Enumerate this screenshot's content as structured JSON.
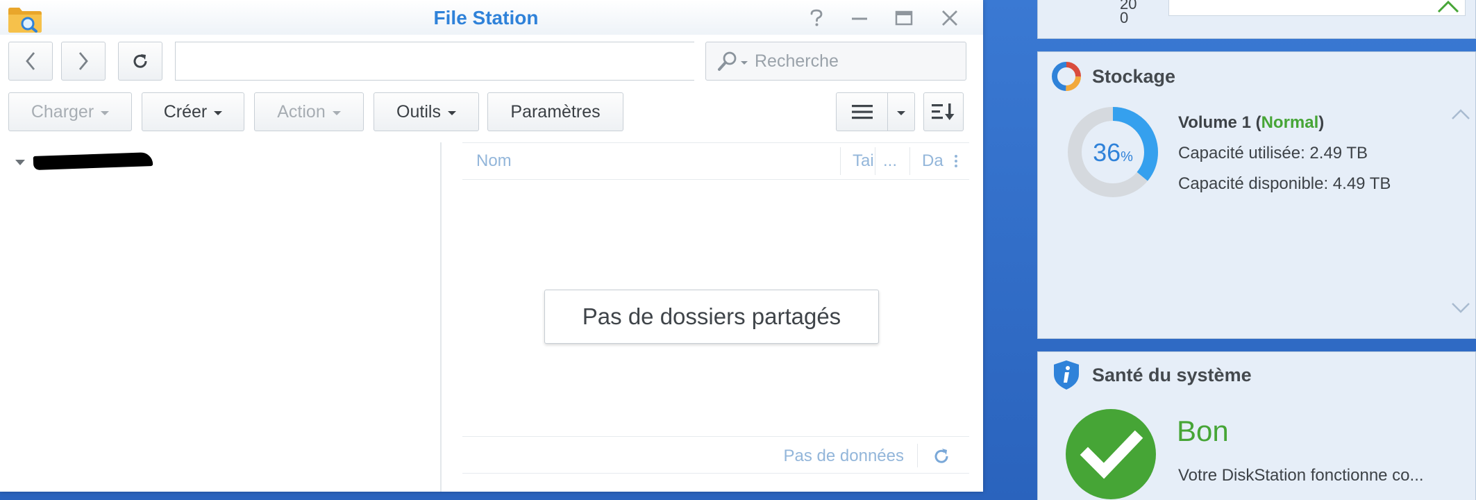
{
  "window": {
    "title": "File Station"
  },
  "toolbar": {
    "search_placeholder": "Recherche",
    "upload_label": "Charger",
    "create_label": "Créer",
    "action_label": "Action",
    "tools_label": "Outils",
    "settings_label": "Paramètres"
  },
  "file_list": {
    "columns": [
      "Nom",
      "Tai",
      "...",
      "Da"
    ],
    "empty_message": "Pas de dossiers partagés",
    "status_text": "Pas de données"
  },
  "widgets": {
    "top_axis": [
      "20",
      "0"
    ],
    "storage": {
      "title": "Stockage",
      "percent": 36,
      "percent_number": "36",
      "percent_sign": "%",
      "volume_prefix": "Volume 1 (",
      "volume_status": "Normal",
      "volume_suffix": ")",
      "used": "Capacité utilisée: 2.49 TB",
      "available": "Capacité disponible: 4.49 TB"
    },
    "health": {
      "title": "Santé du système",
      "status": "Bon",
      "message": "Votre DiskStation fonctionne co..."
    }
  },
  "colors": {
    "accent": "#2f82d9",
    "status_green": "#46a536",
    "donut_track": "#d5d9de",
    "desktop": "#2f6dc7"
  }
}
